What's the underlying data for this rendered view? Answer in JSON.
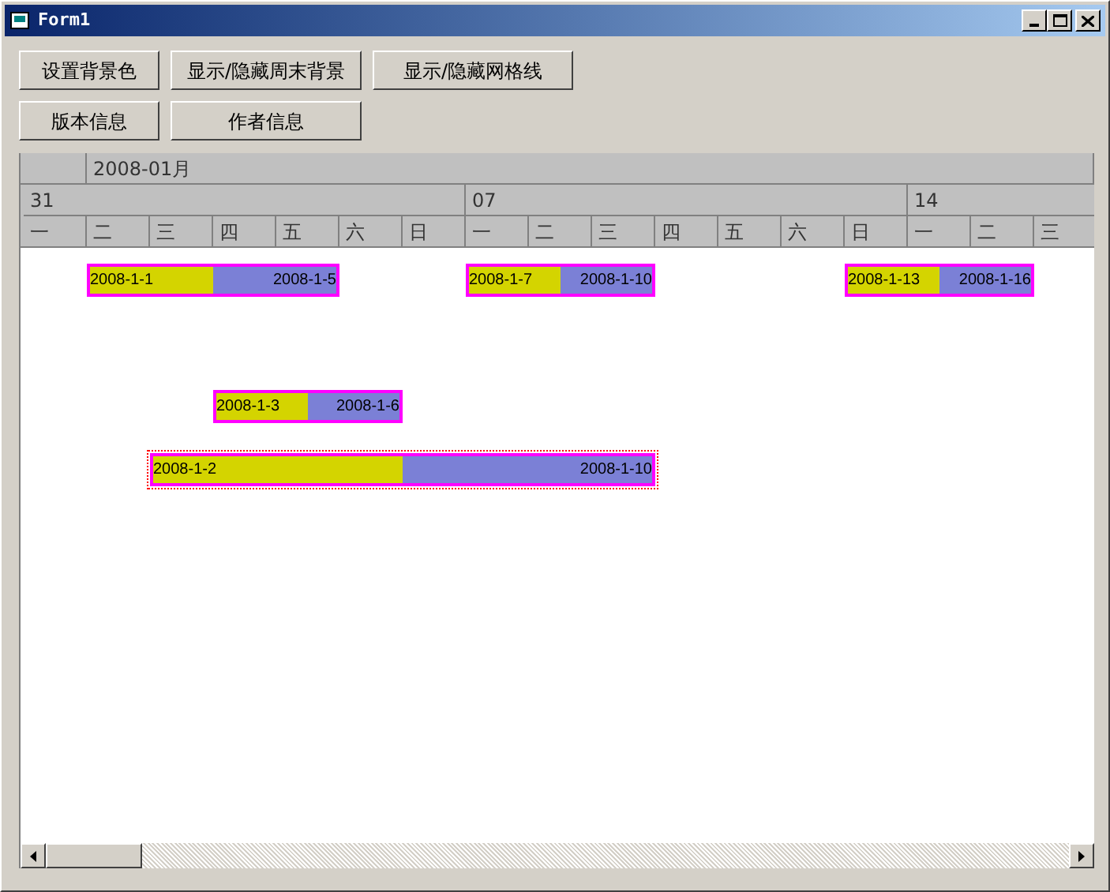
{
  "window": {
    "title": "Form1"
  },
  "buttons": [
    [
      "设置背景色",
      "显示/隐藏周末背景",
      "显示/隐藏网格线"
    ],
    [
      "版本信息",
      "作者信息"
    ]
  ],
  "gantt": {
    "month": "2008-01月",
    "weeks": [
      "31",
      "07",
      "14"
    ],
    "days": [
      "一",
      "二",
      "三",
      "四",
      "五",
      "六",
      "日",
      "一",
      "二",
      "三",
      "四",
      "五",
      "六",
      "日",
      "一",
      "二",
      "三"
    ],
    "rows": [
      {
        "bars": [
          {
            "start": "2008-1-1",
            "end": "2008-1-5",
            "level": 0.5,
            "selected": false
          },
          {
            "start": "2008-1-7",
            "end": "2008-1-10",
            "level": 0.5,
            "selected": false
          },
          {
            "start": "2008-1-13",
            "end": "2008-1-16",
            "level": 0.5,
            "selected": false
          }
        ]
      },
      {},
      {
        "bars": [
          {
            "start": "2008-1-3",
            "end": "2008-1-6",
            "level": 0.5,
            "selected": false
          }
        ]
      },
      {
        "bars": [
          {
            "start": "2008-1-2",
            "end": "2008-1-10",
            "level": 0.5,
            "selected": true
          }
        ]
      }
    ]
  }
}
